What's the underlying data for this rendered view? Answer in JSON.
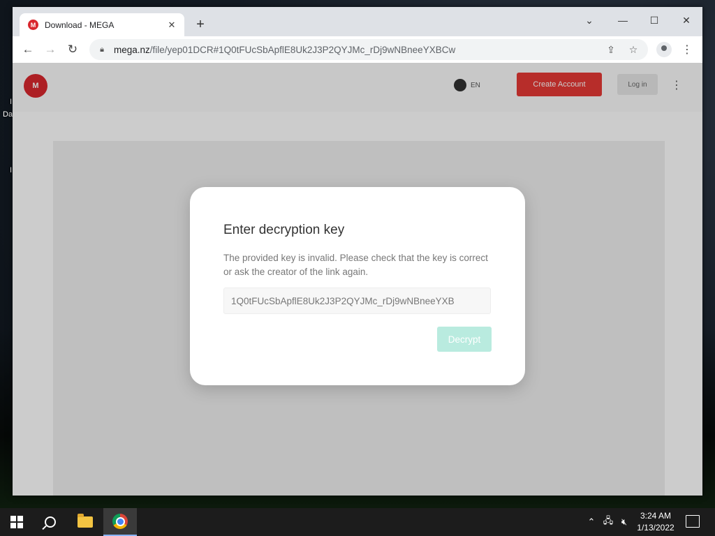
{
  "desktop": {
    "label_1": "I",
    "label_2": "Da",
    "label_3": "I"
  },
  "browser": {
    "tab_title": "Download - MEGA",
    "tab_favicon": "M",
    "new_tab": "+",
    "url_domain": "mega.nz",
    "url_path": "/file/yep01DCR#1Q0tFUcSbApflE8Uk2J3P2QYJMc_rDj9wNBneeYXBCw",
    "icons": [
      "back-icon",
      "forward-icon",
      "reload-icon",
      "lock-icon",
      "share-icon",
      "star-icon",
      "profile-icon",
      "menu-icon",
      "minimize-icon",
      "maximize-icon",
      "close-icon",
      "tab-search-icon"
    ]
  },
  "site": {
    "logo_text": "M",
    "theme_label": "EN",
    "create_account_label": "Create Account",
    "login_label": "Log in"
  },
  "dialog": {
    "title": "Enter decryption key",
    "message": "The provided key is invalid. Please check that the key is correct or ask the creator of the link again.",
    "key_value": "1Q0tFUcSbApflE8Uk2J3P2QYJMc_rDj9wNBneeYXB",
    "decrypt_label": "Decrypt"
  },
  "taskbar": {
    "time": "3:24 AM",
    "date": "1/13/2022",
    "tray_icons": [
      "chevron-up-icon",
      "network-icon",
      "volume-muted-icon"
    ]
  },
  "colors": {
    "mega_red": "#d9272e",
    "decrypt_button": "#b9ebdf",
    "taskbar": "#1c1c1c"
  }
}
